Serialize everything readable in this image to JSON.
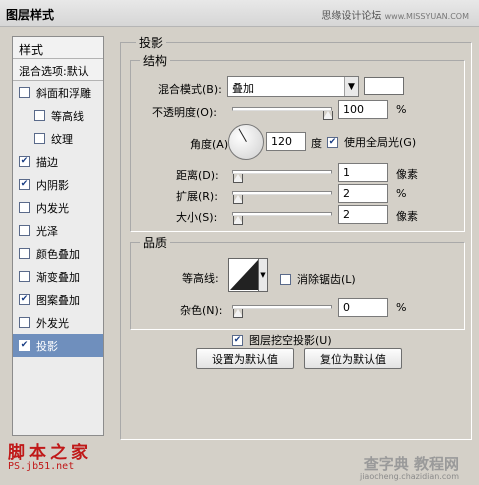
{
  "window": {
    "title": "图层样式",
    "site_name": "思缘设计论坛",
    "site_url": "www.MISSYUAN.COM"
  },
  "sidebar": {
    "header": "样式",
    "blend_options": "混合选项:默认",
    "items": [
      {
        "label": "斜面和浮雕",
        "checked": false,
        "sub": false,
        "active": false
      },
      {
        "label": "等高线",
        "checked": false,
        "sub": true,
        "active": false
      },
      {
        "label": "纹理",
        "checked": false,
        "sub": true,
        "active": false
      },
      {
        "label": "描边",
        "checked": true,
        "sub": false,
        "active": false
      },
      {
        "label": "内阴影",
        "checked": true,
        "sub": false,
        "active": false
      },
      {
        "label": "内发光",
        "checked": false,
        "sub": false,
        "active": false
      },
      {
        "label": "光泽",
        "checked": false,
        "sub": false,
        "active": false
      },
      {
        "label": "颜色叠加",
        "checked": false,
        "sub": false,
        "active": false
      },
      {
        "label": "渐变叠加",
        "checked": false,
        "sub": false,
        "active": false
      },
      {
        "label": "图案叠加",
        "checked": true,
        "sub": false,
        "active": false
      },
      {
        "label": "外发光",
        "checked": false,
        "sub": false,
        "active": false
      },
      {
        "label": "投影",
        "checked": true,
        "sub": false,
        "active": true
      }
    ]
  },
  "panel": {
    "title": "投影",
    "structure": {
      "title": "结构",
      "blend_mode_label": "混合模式(B):",
      "blend_mode_value": "叠加",
      "opacity_label": "不透明度(O):",
      "opacity_value": "100",
      "opacity_fraction": 1.0,
      "percent": "%",
      "angle_label": "角度(A):",
      "angle_value": "120",
      "angle_unit": "度",
      "global_light_label": "使用全局光(G)",
      "global_light_checked": true,
      "distance_label": "距离(D):",
      "distance_value": "1",
      "distance_fraction": 0.0,
      "pixels": "像素",
      "spread_label": "扩展(R):",
      "spread_value": "2",
      "spread_fraction": 0.0,
      "size_label": "大小(S):",
      "size_value": "2",
      "size_fraction": 0.0
    },
    "quality": {
      "title": "品质",
      "contour_label": "等高线:",
      "anti_alias_label": "消除锯齿(L)",
      "anti_alias_checked": false,
      "noise_label": "杂色(N):",
      "noise_value": "0",
      "noise_fraction": 0.0,
      "percent": "%"
    },
    "knockout_label": "图层挖空投影(U)",
    "knockout_checked": true,
    "make_default_label": "设置为默认值",
    "reset_default_label": "复位为默认值"
  },
  "watermarks": {
    "left_title": "脚本之家",
    "left_url": "PS.jb51.net",
    "right_title": "查字典 教程网",
    "right_url": "jiaocheng.chazidian.com"
  },
  "colors": {
    "active_item": "#6f8fbd",
    "dialog_bg": "#d4d0c8"
  }
}
